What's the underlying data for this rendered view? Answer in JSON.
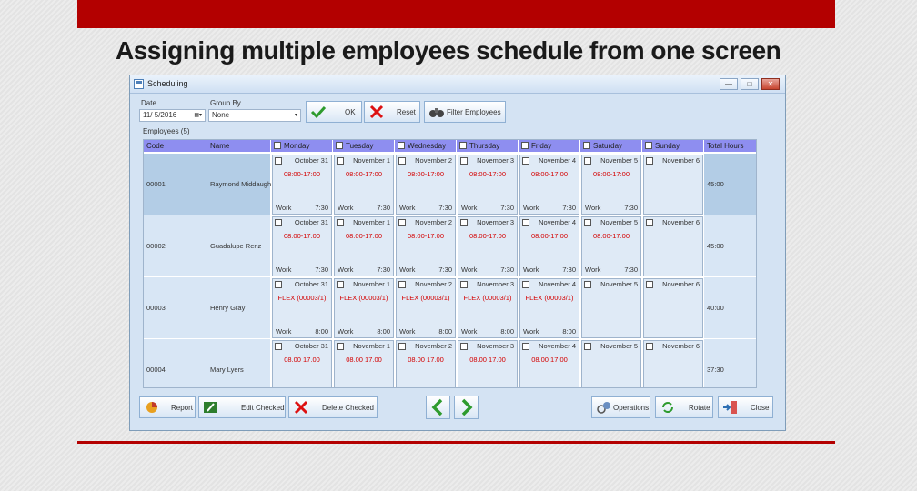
{
  "slide": {
    "title": "Assigning multiple employees schedule from one screen"
  },
  "window": {
    "title": "Scheduling",
    "minimize_label": "—",
    "maximize_label": "□",
    "close_label": "✕"
  },
  "filters": {
    "date_label": "Date",
    "date_value": "11/ 5/2016",
    "group_label": "Group By",
    "group_value": "None",
    "employees_label": "Employees (5)"
  },
  "toolbar": {
    "ok_label": "OK",
    "reset_label": "Reset",
    "filter_label": "Filter Employees"
  },
  "grid": {
    "columns": [
      "Code",
      "Name",
      "Monday",
      "Tuesday",
      "Wednesday",
      "Thursday",
      "Friday",
      "Saturday",
      "Sunday",
      "Total Hours"
    ],
    "rows": [
      {
        "code": "00001",
        "name": "Raymond Middaugh",
        "total": "45:00",
        "days": [
          {
            "date": "October 31",
            "shift": "08:00-17:00",
            "work": "Work",
            "hours": "7:30"
          },
          {
            "date": "November 1",
            "shift": "08:00-17:00",
            "work": "Work",
            "hours": "7:30"
          },
          {
            "date": "November 2",
            "shift": "08:00-17:00",
            "work": "Work",
            "hours": "7:30"
          },
          {
            "date": "November 3",
            "shift": "08:00-17:00",
            "work": "Work",
            "hours": "7:30"
          },
          {
            "date": "November 4",
            "shift": "08:00-17:00",
            "work": "Work",
            "hours": "7:30"
          },
          {
            "date": "November 5",
            "shift": "08:00-17:00",
            "work": "Work",
            "hours": "7:30"
          },
          {
            "date": "November 6",
            "shift": "",
            "work": "",
            "hours": ""
          }
        ]
      },
      {
        "code": "00002",
        "name": "Guadalupe Renz",
        "total": "45:00",
        "days": [
          {
            "date": "October 31",
            "shift": "08:00-17:00",
            "work": "Work",
            "hours": "7:30"
          },
          {
            "date": "November 1",
            "shift": "08:00-17:00",
            "work": "Work",
            "hours": "7:30"
          },
          {
            "date": "November 2",
            "shift": "08:00-17:00",
            "work": "Work",
            "hours": "7:30"
          },
          {
            "date": "November 3",
            "shift": "08:00-17:00",
            "work": "Work",
            "hours": "7:30"
          },
          {
            "date": "November 4",
            "shift": "08:00-17:00",
            "work": "Work",
            "hours": "7:30"
          },
          {
            "date": "November 5",
            "shift": "08:00-17:00",
            "work": "Work",
            "hours": "7:30"
          },
          {
            "date": "November 6",
            "shift": "",
            "work": "",
            "hours": ""
          }
        ]
      },
      {
        "code": "00003",
        "name": "Henry Gray",
        "total": "40:00",
        "days": [
          {
            "date": "October 31",
            "shift": "FLEX (00003/1)",
            "work": "Work",
            "hours": "8:00"
          },
          {
            "date": "November 1",
            "shift": "FLEX (00003/1)",
            "work": "Work",
            "hours": "8:00"
          },
          {
            "date": "November 2",
            "shift": "FLEX (00003/1)",
            "work": "Work",
            "hours": "8:00"
          },
          {
            "date": "November 3",
            "shift": "FLEX (00003/1)",
            "work": "Work",
            "hours": "8:00"
          },
          {
            "date": "November 4",
            "shift": "FLEX (00003/1)",
            "work": "Work",
            "hours": "8:00"
          },
          {
            "date": "November 5",
            "shift": "",
            "work": "",
            "hours": ""
          },
          {
            "date": "November 6",
            "shift": "",
            "work": "",
            "hours": ""
          }
        ]
      },
      {
        "code": "00004",
        "name": "Mary Lyers",
        "total": "37:30",
        "days": [
          {
            "date": "October 31",
            "shift": "08.00 17.00",
            "work": "",
            "hours": ""
          },
          {
            "date": "November 1",
            "shift": "08.00 17.00",
            "work": "",
            "hours": ""
          },
          {
            "date": "November 2",
            "shift": "08.00 17.00",
            "work": "",
            "hours": ""
          },
          {
            "date": "November 3",
            "shift": "08.00 17.00",
            "work": "",
            "hours": ""
          },
          {
            "date": "November 4",
            "shift": "08.00 17.00",
            "work": "",
            "hours": ""
          },
          {
            "date": "November 5",
            "shift": "",
            "work": "",
            "hours": ""
          },
          {
            "date": "November 6",
            "shift": "",
            "work": "",
            "hours": ""
          }
        ]
      }
    ]
  },
  "bottom": {
    "report_label": "Report",
    "edit_label": "Edit Checked",
    "delete_label": "Delete Checked",
    "operations_label": "Operations",
    "rotate_label": "Rotate",
    "close_label": "Close"
  },
  "colors": {
    "slide_accent": "#b30000",
    "header_bg": "#8e8ef0",
    "shift_text": "#d40000",
    "cell_bg": "#d8e6f5"
  }
}
